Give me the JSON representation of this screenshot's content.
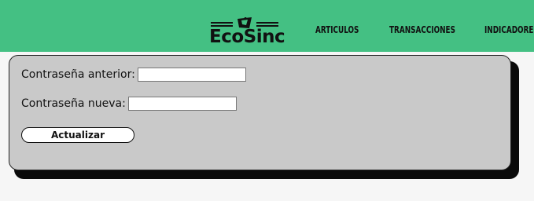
{
  "header": {
    "logo_text": "EcoSinc",
    "nav": [
      {
        "label": "ARTICULOS"
      },
      {
        "label": "TRANSACCIONES"
      },
      {
        "label": "INDICADORES"
      }
    ]
  },
  "form": {
    "old_password_label": "Contraseña anterior:",
    "old_password_value": "",
    "new_password_label": "Contraseña nueva:",
    "new_password_value": "",
    "submit_label": "Actualizar"
  },
  "colors": {
    "header_bg": "#44c083",
    "card_bg": "#c9c9c9",
    "card_shadow": "#0a0a0a",
    "page_bg": "#f6f6f6"
  }
}
